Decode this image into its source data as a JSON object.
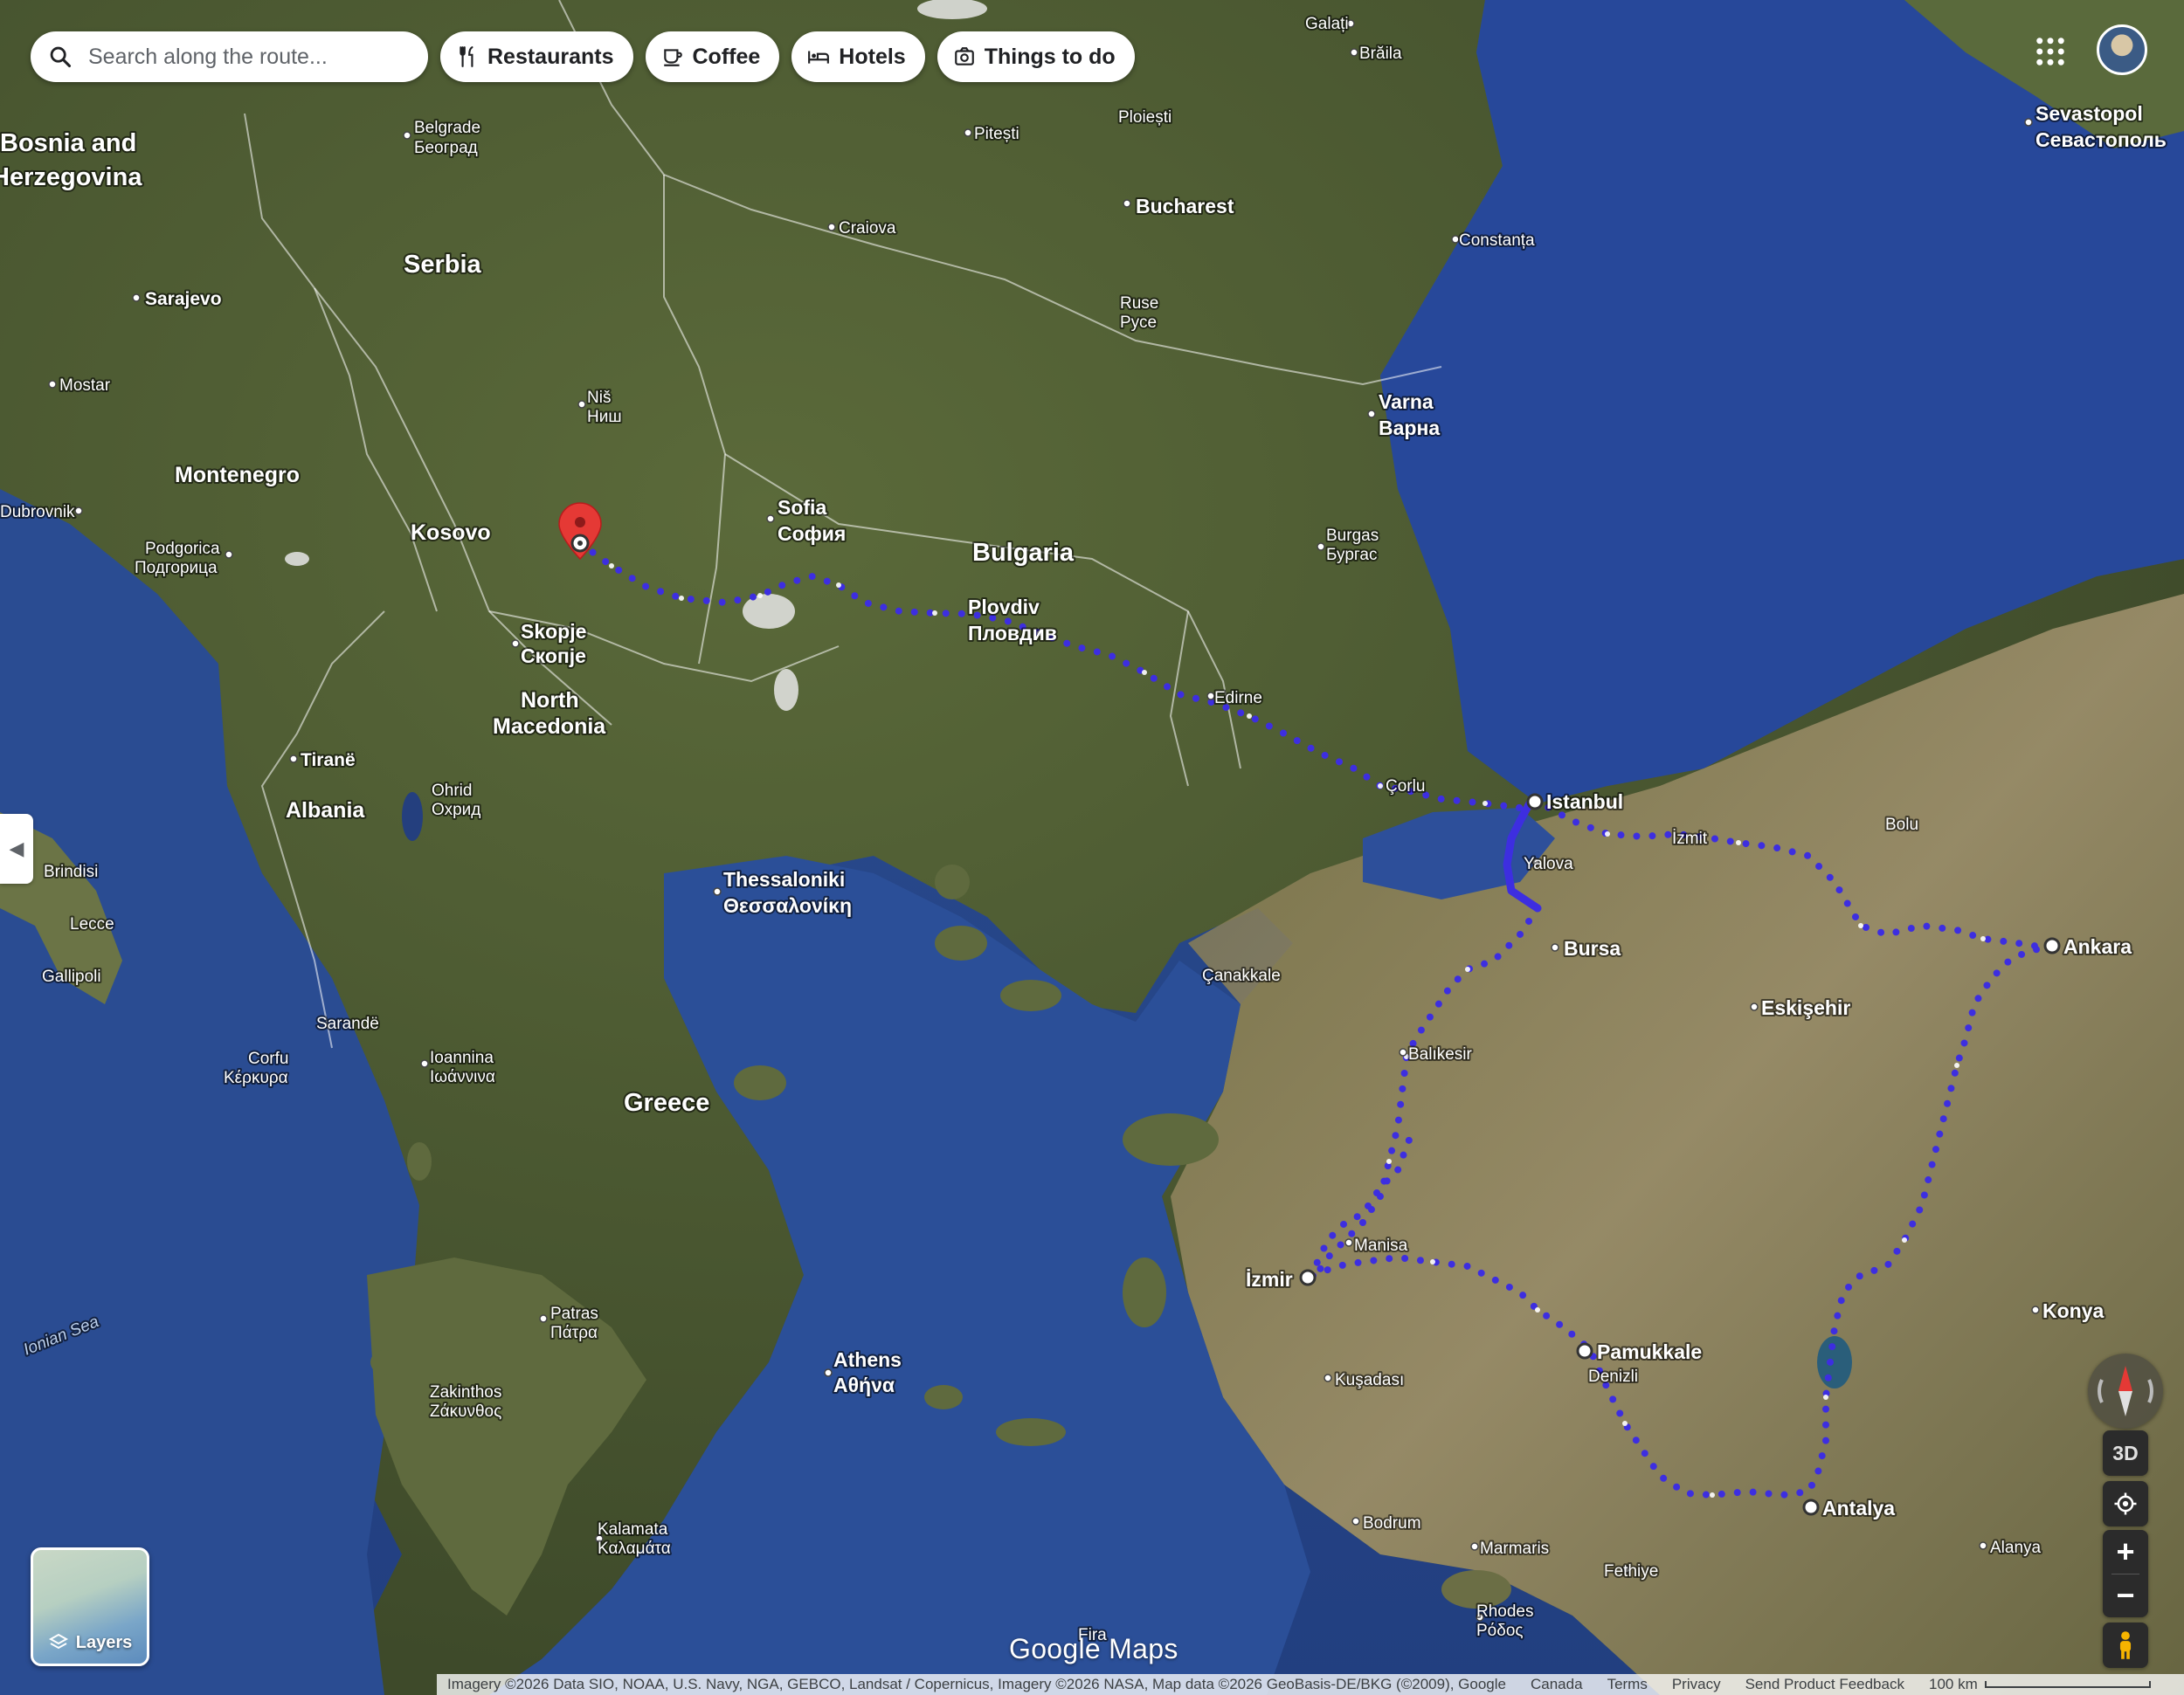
{
  "search": {
    "placeholder": "Search along the route..."
  },
  "chips": [
    {
      "label": "Restaurants",
      "icon": "fork-knife-icon"
    },
    {
      "label": "Coffee",
      "icon": "coffee-cup-icon"
    },
    {
      "label": "Hotels",
      "icon": "bed-icon"
    },
    {
      "label": "Things to do",
      "icon": "camera-icon"
    }
  ],
  "controls": {
    "three_d": "3D",
    "zoom_in": "+",
    "zoom_out": "−",
    "layers": "Layers"
  },
  "watermark": "Google Maps",
  "footer": {
    "attribution": "Imagery ©2026 Data SIO, NOAA, U.S. Navy, NGA, GEBCO, Landsat / Copernicus, Imagery ©2026 NASA, Map data ©2026 GeoBasis-DE/BKG (©2009), Google",
    "links": [
      "Canada",
      "Terms",
      "Privacy",
      "Send Product Feedback"
    ],
    "scale": "100 km"
  },
  "map": {
    "countries": [
      "Bosnia and",
      "Herzegovina",
      "Serbia",
      "Montenegro",
      "Kosovo",
      "North",
      "Macedonia",
      "Albania",
      "Greece",
      "Bulgaria"
    ],
    "cities": [
      {
        "name": "Belgrade",
        "alt": "Београд"
      },
      {
        "name": "Sarajevo"
      },
      {
        "name": "Mostar"
      },
      {
        "name": "Dubrovnik"
      },
      {
        "name": "Podgorica",
        "alt": "Подгорица"
      },
      {
        "name": "Niš",
        "alt": "Ниш"
      },
      {
        "name": "Skopje",
        "alt": "Скопје"
      },
      {
        "name": "Tiranë"
      },
      {
        "name": "Ohrid",
        "alt": "Охрид"
      },
      {
        "name": "Sofia",
        "alt": "София"
      },
      {
        "name": "Plovdiv",
        "alt": "Пловдив"
      },
      {
        "name": "Craiova"
      },
      {
        "name": "Pitești"
      },
      {
        "name": "Ploiești"
      },
      {
        "name": "Bucharest"
      },
      {
        "name": "Galați"
      },
      {
        "name": "Brăila"
      },
      {
        "name": "Constanța"
      },
      {
        "name": "Ruse",
        "alt": "Русе"
      },
      {
        "name": "Varna",
        "alt": "Варна"
      },
      {
        "name": "Burgas",
        "alt": "Бургас"
      },
      {
        "name": "Edirne"
      },
      {
        "name": "Çorlu"
      },
      {
        "name": "Istanbul"
      },
      {
        "name": "İzmit"
      },
      {
        "name": "Yalova"
      },
      {
        "name": "Bolu"
      },
      {
        "name": "Bursa"
      },
      {
        "name": "Ankara"
      },
      {
        "name": "Eskişehir"
      },
      {
        "name": "Çanakkale"
      },
      {
        "name": "Balıkesir"
      },
      {
        "name": "Manisa"
      },
      {
        "name": "İzmir"
      },
      {
        "name": "Pamukkale"
      },
      {
        "name": "Denizli"
      },
      {
        "name": "Kuşadası"
      },
      {
        "name": "Konya"
      },
      {
        "name": "Antalya"
      },
      {
        "name": "Alanya"
      },
      {
        "name": "Bodrum"
      },
      {
        "name": "Marmaris"
      },
      {
        "name": "Fethiye"
      },
      {
        "name": "Rhodes",
        "alt": "Ρόδος"
      },
      {
        "name": "Thessaloniki",
        "alt": "Θεσσαλονίκη"
      },
      {
        "name": "Athens",
        "alt": "Αθήνα"
      },
      {
        "name": "Patras",
        "alt": "Πάτρα"
      },
      {
        "name": "Ioannina",
        "alt": "Ιωάννινα"
      },
      {
        "name": "Corfu",
        "alt": "Κέρκυρα"
      },
      {
        "name": "Sarandë"
      },
      {
        "name": "Zakinthos",
        "alt": "Ζάκυνθος"
      },
      {
        "name": "Kalamata",
        "alt": "Καλαμάτα"
      },
      {
        "name": "Brindisi"
      },
      {
        "name": "Lecce"
      },
      {
        "name": "Gallipoli"
      },
      {
        "name": "Sevastopol",
        "alt": "Севастополь"
      },
      {
        "name": "Fira"
      }
    ],
    "seas": [
      "Ionian Sea"
    ],
    "route_color": "#3d2ee0"
  }
}
